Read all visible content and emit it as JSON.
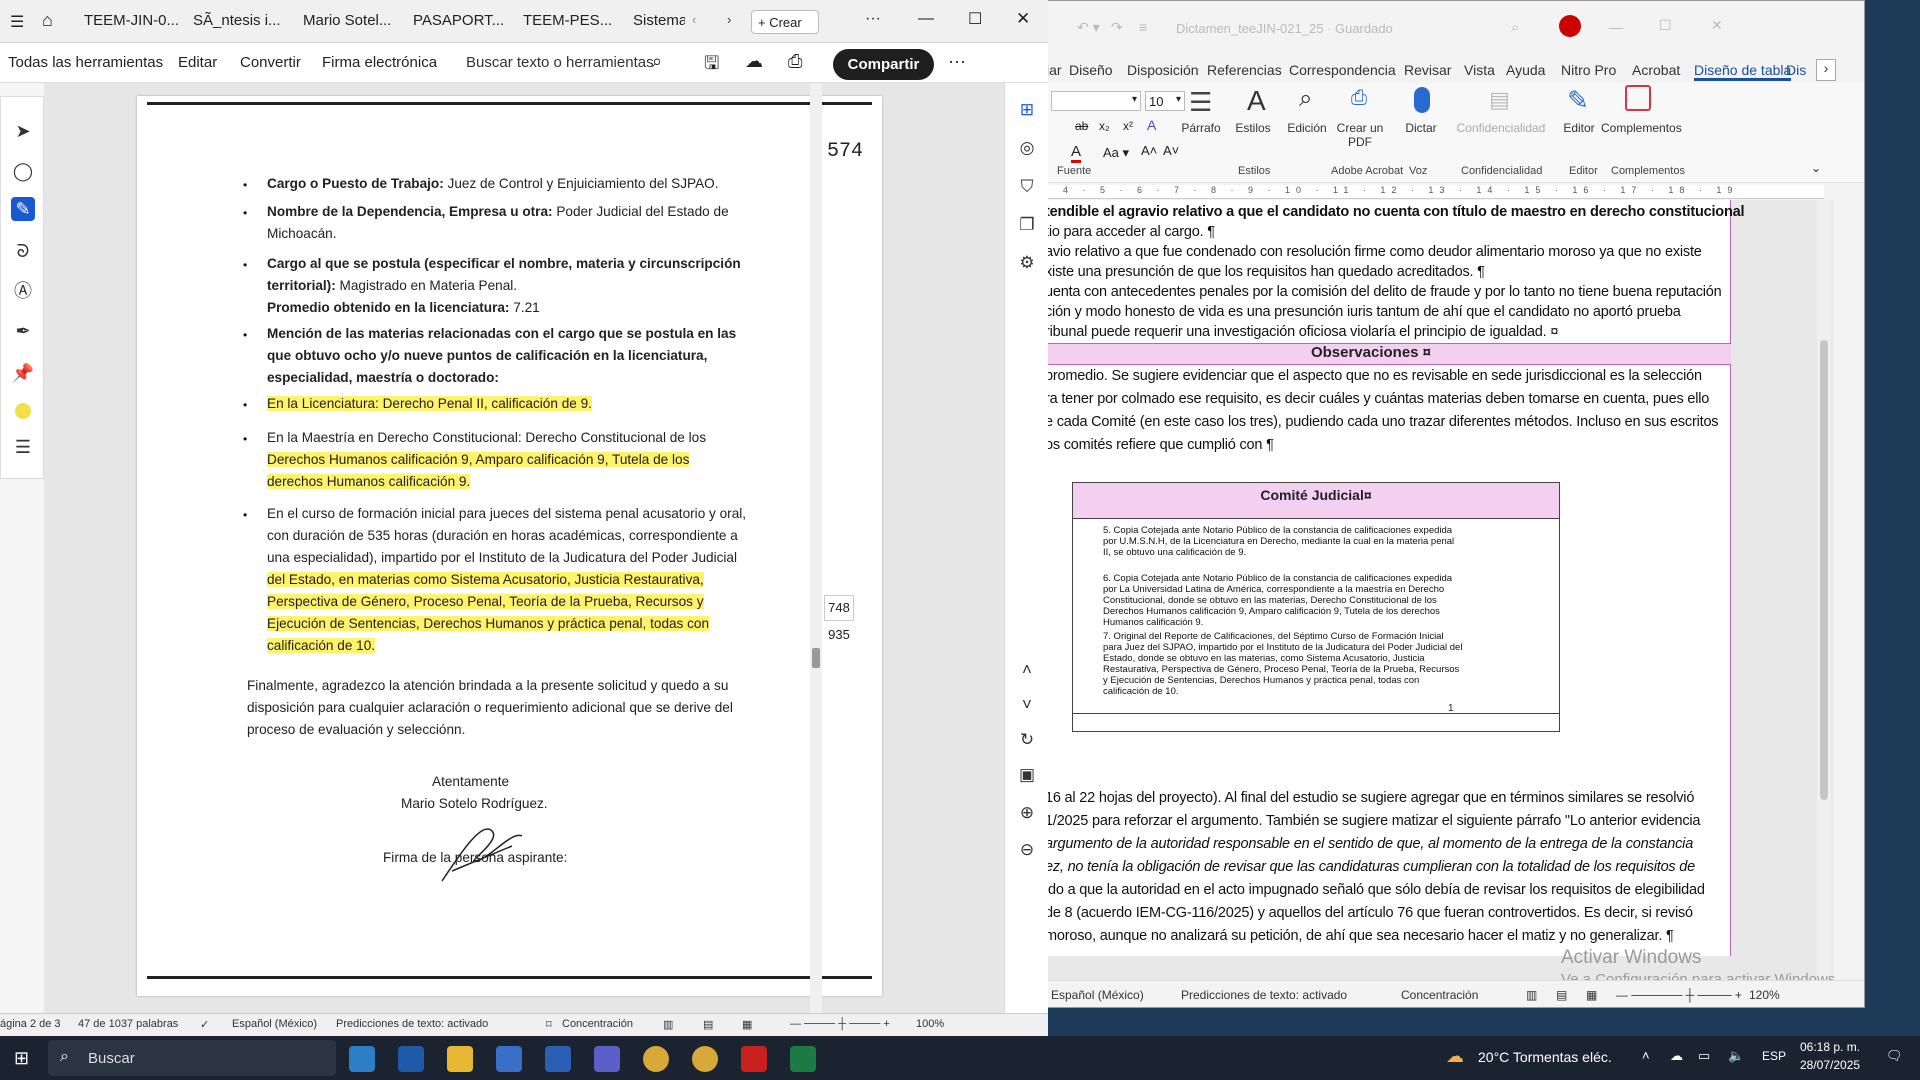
{
  "acrobat": {
    "tabs": [
      "TEEM-JIN-0...",
      "SÃ_ntesis i...",
      "Mario Sotel...",
      "PASAPORT...",
      "TEEM-PES...",
      "Sistema"
    ],
    "create_label": "Crear",
    "toolbar": {
      "all_tools": "Todas las herramientas",
      "edit": "Editar",
      "convert": "Convertir",
      "esign": "Firma electrónica",
      "search_placeholder": "Buscar texto o herramientas",
      "share": "Compartir"
    },
    "page_counter": {
      "current": "748",
      "total": "935"
    },
    "status": {
      "page": "ágina 2 de 3",
      "words": "47 de 1037 palabras",
      "lang": "Español (México)",
      "predictions": "Predicciones de texto: activado",
      "focus": "Concentración",
      "zoom": "100%"
    },
    "document": {
      "stamp_number": "574",
      "lines": [
        {
          "b": "Cargo o Puesto de Trabajo:",
          "t": " Juez de Control y Enjuiciamiento del SJPAO."
        },
        {
          "b": "Nombre de la Dependencia, Empresa u otra:",
          "t": " Poder Judicial del Estado de"
        },
        {
          "b": "",
          "t": "Michoacán."
        },
        {
          "b": "Cargo al que se postula (especificar el nombre, materia y circunscripción",
          "t": ""
        },
        {
          "b": "territorial):",
          "t": " Magistrado en Materia Penal."
        },
        {
          "b": "Promedio obtenido en la licenciatura:",
          "t": " 7.21"
        },
        {
          "b": "Mención de las materias relacionadas con el cargo que se postula en las",
          "t": ""
        },
        {
          "b": "que obtuvo ocho y/o nueve puntos de calificación en la licenciatura,",
          "t": ""
        },
        {
          "b": "especialidad, maestría o doctorado:",
          "t": ""
        }
      ],
      "subitems": [
        "En la Licenciatura: Derecho Penal II, calificación de 9.",
        "En la Maestría en Derecho Constitucional: Derecho Constitucional de los",
        "Derechos Humanos calificación 9, Amparo calificación 9, Tutela de los",
        "derechos Humanos calificación 9.",
        "En el curso de formación inicial para jueces del sistema penal acusatorio y oral,",
        "con duración de 535 horas (duración en horas académicas, correspondiente a",
        "una especialidad), impartido por el Instituto de la Judicatura del Poder Judicial",
        "del Estado,  en materias como Sistema Acusatorio, Justicia Restaurativa,",
        "Perspectiva de Género, Proceso Penal, Teoría de la Prueba, Recursos y",
        "Ejecución de Sentencias, Derechos Humanos y práctica penal, todas con",
        "calificación de 10."
      ],
      "closing": [
        "Finalmente, agradezco la atención brindada a la presente solicitud y quedo a su",
        "disposición para cualquier aclaración o requerimiento adicional que se derive del",
        "proceso de evaluación y selecciónn."
      ],
      "regards": "Atentamente",
      "name": "Mario Sotelo Rodríguez.",
      "signature_label": "Firma de la persona aspirante:"
    }
  },
  "word": {
    "title": "Dictamen_teeJIN-021_25 · Guardado",
    "tabs": [
      "iar",
      "Diseño",
      "Disposición",
      "Referencias",
      "Correspondencia",
      "Revisar",
      "Vista",
      "Ayuda",
      "Nitro Pro",
      "Acrobat",
      "Diseño de tabla",
      "Dis"
    ],
    "font_size": "10",
    "ribbon": {
      "parrafo": "Párrafo",
      "estilos": "Estilos",
      "edicion": "Edición",
      "crear_pdf": "Crear un PDF",
      "dictar": "Dictar",
      "confidencialidad": "Confidencialidad",
      "editor": "Editor",
      "complementos": "Complementos"
    },
    "groups": [
      "Fuente",
      "Estilos",
      "Adobe Acrobat",
      "Voz",
      "Confidencialidad",
      "Editor",
      "Complementos"
    ],
    "ruler": "4 · 5 · 6 · 7 · 8 · 9 · 10 · 11 · 12 · 13 · 14 · 15 · 16 · 17 · 18 · 19",
    "lines": [
      "tendible el agravio relativo a que el candidato no cuenta con título de maestro en derecho constitucional",
      "tio para acceder al cargo. ¶",
      "avio relativo a que fue condenado con resolución firme como deudor alimentario moroso ya que no existe",
      "xiste una presunción de que los requisitos han quedado acreditados. ¶",
      "uenta con antecedentes penales por la comisión del delito de fraude y por lo tanto no tiene buena reputación",
      "ción y modo honesto de vida es una presunción iuris tantum de ahí que el candidato no aportó prueba",
      "ribunal puede requerir una investigación oficiosa violaría el principio de igualdad. ¤"
    ],
    "obs_header": "Observaciones ¤",
    "obs_lines": [
      "promedio. Se sugiere evidenciar que el aspecto que no es revisable en sede jurisdiccional es la selección",
      "ra tener por colmado ese requisito, es decir cuáles y cuántas materias deben tomarse en cuenta, pues ello",
      "e cada Comité (en este caso los tres), pudiendo cada uno trazar diferentes métodos. Incluso en sus escritos",
      "os comités refiere que cumplió con ¶"
    ],
    "comite": {
      "header": "Comité Judicial¤",
      "items": [
        "5. Copia Cotejada ante Notario Público de la constancia de calificaciones expedida por U.M.S.N.H, de la Licenciatura en Derecho, mediante la cual en la materia penal II, se obtuvo una calificación de 9.",
        "6. Copia Cotejada ante Notario Público de la constancia de calificaciones expedida por La Universidad Latina de América, correspondiente a la maestría en Derecho Constitucional, donde se obtuvo en las materias, Derecho Constitucional de los Derechos Humanos calificación 9, Amparo calificación 9, Tutela de los derechos Humanos calificación 9.",
        "7. Original del Reporte de Calificaciones, del Séptimo Curso de Formación Inicial para Juez del SJPAO, impartido por el Instituto de la Judicatura del Poder Judicial del Estado, donde se obtuvo en las materias, como Sistema Acusatorio, Justicia Restaurativa, Perspectiva de Género, Proceso Penal, Teoría de la Prueba, Recursos y Ejecución de Sentencias, Derechos Humanos y práctica penal, todas con calificación de 10."
      ],
      "page_mark": "1"
    },
    "lines2": [
      "16 al 22 hojas del proyecto). Al final del estudio se sugiere agregar que en términos similares se resolvió",
      "1/2025 para reforzar el argumento. También se sugiere matizar el siguiente párrafo \"Lo anterior evidencia",
      "argumento de la autoridad responsable en el sentido de que, al momento de la entrega de la constancia",
      "ez, no tenía la obligación de revisar que las candidaturas cumplieran con la totalidad de los requisitos de",
      "ido a que la autoridad en el acto impugnado señaló que sólo debía de revisar los requisitos de elegibilidad",
      "de 8 (acuerdo IEM-CG-116/2025) y aquellos del artículo 76 que fueran controvertidos. Es decir, si revisó",
      "moroso, aunque no analizará su petición, de ahí que sea necesario hacer el matiz y no generalizar. ¶"
    ],
    "status": {
      "lang": "Español (México)",
      "predictions": "Predicciones de texto: activado",
      "focus": "Concentración",
      "zoom": "120%"
    },
    "watermark_1": "Activar Windows",
    "watermark_2": "Ve a Configuración para activar Windows."
  },
  "taskbar": {
    "search": "Buscar",
    "weather": "20°C  Tormentas eléc.",
    "lang": "ESP",
    "time": "06:18 p. m.",
    "date": "28/07/2025"
  }
}
